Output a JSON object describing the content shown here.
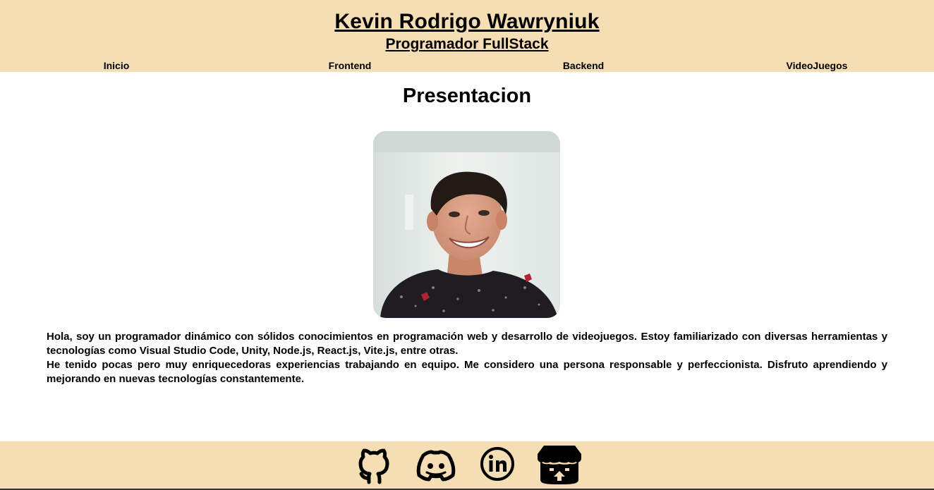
{
  "header": {
    "title": "Kevin Rodrigo Wawryniuk",
    "subtitle": "Programador FullStack"
  },
  "nav": {
    "items": [
      {
        "label": "Inicio"
      },
      {
        "label": "Frontend"
      },
      {
        "label": "Backend"
      },
      {
        "label": "VideoJuegos"
      }
    ]
  },
  "main": {
    "section_title": "Presentacion",
    "photo_alt": "Foto de perfil",
    "paragraphs": [
      "Hola, soy un programador dinámico con sólidos conocimientos en programación web y desarrollo de videojuegos. Estoy familiarizado con diversas herramientas y tecnologías como Visual Studio Code, Unity, Node.js, React.js, Vite.js, entre otras.",
      "He tenido pocas pero muy enriquecedoras experiencias trabajando en equipo. Me considero una persona responsable y perfeccionista. Disfruto aprendiendo y mejorando en nuevas tecnologías constantemente."
    ]
  },
  "footer": {
    "social": [
      {
        "icon": "github-icon"
      },
      {
        "icon": "discord-icon"
      },
      {
        "icon": "linkedin-icon"
      },
      {
        "icon": "itchio-icon"
      }
    ]
  },
  "colors": {
    "header_bg": "#f5ddb4",
    "footer_bg": "#f5ddb4",
    "text": "#000000",
    "page_bg": "#ffffff"
  }
}
